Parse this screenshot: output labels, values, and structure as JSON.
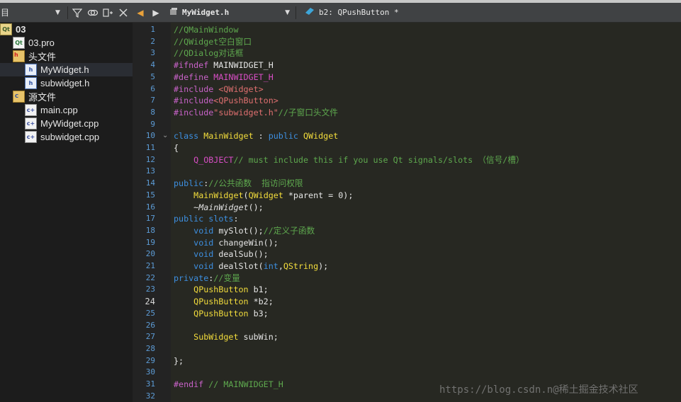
{
  "left_panel": {
    "title": "目",
    "toolbar_icons": [
      "filter-icon",
      "link-icon",
      "split-icon",
      "close-icon"
    ],
    "tree": [
      {
        "label": "03",
        "icon": "project-icon",
        "indent": 0,
        "bold": true
      },
      {
        "label": "03.pro",
        "icon": "pro-file-icon",
        "indent": 1
      },
      {
        "label": "头文件",
        "icon": "header-folder-icon",
        "indent": 1
      },
      {
        "label": "MyWidget.h",
        "icon": "header-file-icon",
        "indent": 2,
        "selected": true
      },
      {
        "label": "subwidget.h",
        "icon": "header-file-icon",
        "indent": 2
      },
      {
        "label": "源文件",
        "icon": "source-folder-icon",
        "indent": 1
      },
      {
        "label": "main.cpp",
        "icon": "cpp-file-icon",
        "indent": 2
      },
      {
        "label": "MyWidget.cpp",
        "icon": "cpp-file-icon",
        "indent": 2
      },
      {
        "label": "subwidget.cpp",
        "icon": "cpp-file-icon",
        "indent": 2
      }
    ]
  },
  "editor_toolbar": {
    "file_name": "MyWidget.h",
    "symbol": "b2: QPushButton *"
  },
  "editor": {
    "current_line": 24,
    "lines": [
      [
        [
          "c-comment",
          "//QMainWindow"
        ]
      ],
      [
        [
          "c-comment",
          "//QWidget空白窗口"
        ]
      ],
      [
        [
          "c-comment",
          "//QDialog对话框"
        ]
      ],
      [
        [
          "c-pre",
          "#ifndef"
        ],
        [
          "c-plain",
          " MAINWIDGET_H"
        ]
      ],
      [
        [
          "c-pre",
          "#define"
        ],
        [
          "c-macro",
          " MAINWIDGET_H"
        ]
      ],
      [
        [
          "c-pre",
          "#include"
        ],
        [
          "c-str",
          " <QWidget>"
        ]
      ],
      [
        [
          "c-pre",
          "#include"
        ],
        [
          "c-str",
          "<QPushButton>"
        ]
      ],
      [
        [
          "c-pre",
          "#include"
        ],
        [
          "c-str",
          "\"subwidget.h\""
        ],
        [
          "c-comment",
          "//子窗口头文件"
        ]
      ],
      [],
      [
        [
          "c-kw",
          "class"
        ],
        [
          "c-plain",
          " "
        ],
        [
          "c-type",
          "MainWidget"
        ],
        [
          "c-plain",
          " : "
        ],
        [
          "c-kw",
          "public"
        ],
        [
          "c-plain",
          " "
        ],
        [
          "c-type",
          "QWidget"
        ]
      ],
      [
        [
          "c-plain",
          "{"
        ]
      ],
      [
        [
          "c-plain",
          "    "
        ],
        [
          "c-macro",
          "Q_OBJECT"
        ],
        [
          "c-comment",
          "// must include this if you use Qt signals/slots （信号/槽）"
        ]
      ],
      [],
      [
        [
          "c-kw",
          "public"
        ],
        [
          "c-plain",
          ":"
        ],
        [
          "c-comment",
          "//公共函数  指访问权限"
        ]
      ],
      [
        [
          "c-plain",
          "    "
        ],
        [
          "c-type",
          "MainWidget"
        ],
        [
          "c-plain",
          "("
        ],
        [
          "c-type",
          "QWidget"
        ],
        [
          "c-plain",
          " *parent = 0);"
        ]
      ],
      [
        [
          "c-plain",
          "    ~"
        ],
        [
          "c-it",
          "MainWidget"
        ],
        [
          "c-plain",
          "();"
        ]
      ],
      [
        [
          "c-kw",
          "public"
        ],
        [
          "c-plain",
          " "
        ],
        [
          "c-kw",
          "slots"
        ],
        [
          "c-plain",
          ":"
        ]
      ],
      [
        [
          "c-plain",
          "    "
        ],
        [
          "c-kw",
          "void"
        ],
        [
          "c-plain",
          " mySlot();"
        ],
        [
          "c-comment",
          "//定义子函数"
        ]
      ],
      [
        [
          "c-plain",
          "    "
        ],
        [
          "c-kw",
          "void"
        ],
        [
          "c-plain",
          " changeWin();"
        ]
      ],
      [
        [
          "c-plain",
          "    "
        ],
        [
          "c-kw",
          "void"
        ],
        [
          "c-plain",
          " dealSub();"
        ]
      ],
      [
        [
          "c-plain",
          "    "
        ],
        [
          "c-kw",
          "void"
        ],
        [
          "c-plain",
          " dealSlot("
        ],
        [
          "c-kw",
          "int"
        ],
        [
          "c-plain",
          ","
        ],
        [
          "c-type",
          "QString"
        ],
        [
          "c-plain",
          ");"
        ]
      ],
      [
        [
          "c-kw",
          "private"
        ],
        [
          "c-plain",
          ":"
        ],
        [
          "c-comment",
          "//变量"
        ]
      ],
      [
        [
          "c-plain",
          "    "
        ],
        [
          "c-type",
          "QPushButton"
        ],
        [
          "c-plain",
          " b1;"
        ]
      ],
      [
        [
          "c-plain",
          "    "
        ],
        [
          "c-type",
          "QPushButton"
        ],
        [
          "c-plain",
          " *b2;"
        ]
      ],
      [
        [
          "c-plain",
          "    "
        ],
        [
          "c-type",
          "QPushButton"
        ],
        [
          "c-plain",
          " b3;"
        ]
      ],
      [],
      [
        [
          "c-plain",
          "    "
        ],
        [
          "c-type",
          "SubWidget"
        ],
        [
          "c-plain",
          " subWin;"
        ]
      ],
      [],
      [
        [
          "c-plain",
          "};"
        ]
      ],
      [],
      [
        [
          "c-pre",
          "#endif"
        ],
        [
          "c-comment",
          " // MAINWIDGET_H"
        ]
      ],
      []
    ]
  },
  "watermark": "https://blog.csdn.n@稀土掘金技术社区"
}
